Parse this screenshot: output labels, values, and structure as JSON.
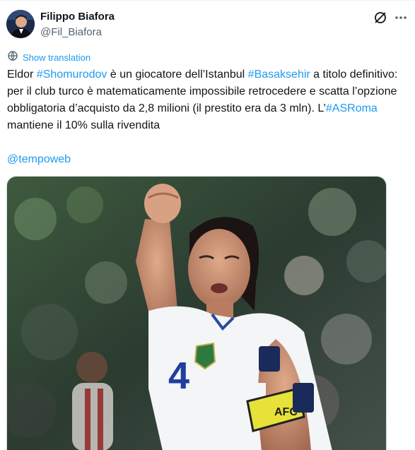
{
  "author": {
    "name": "Filippo Biafora",
    "handle": "@Fil_Biafora"
  },
  "translate_label": "Show translation",
  "tweet": {
    "segments": [
      {
        "text": "Eldor ",
        "link": false
      },
      {
        "text": "#Shomurodov",
        "link": true
      },
      {
        "text": " è un giocatore dell’Istanbul ",
        "link": false
      },
      {
        "text": "#Basaksehir",
        "link": true
      },
      {
        "text": " a titolo definitivo: per il club turco è matematicamente impossibile retrocedere e scatta l’opzione obbligatoria d’acquisto da 2,8 milioni (il prestito era da 3 mln). L’",
        "link": false
      },
      {
        "text": "#ASRoma",
        "link": true
      },
      {
        "text": " mantiene il 10% sulla rivendita",
        "link": false
      }
    ],
    "mention": "@tempoweb"
  },
  "media": {
    "description_icon": "photo-football-player",
    "jersey_number": "4",
    "armband_text": "AFC",
    "accent_color": "#1d9bf0"
  },
  "icons": {
    "grok": "grok-icon",
    "more": "more-icon",
    "translate": "translate-icon"
  }
}
